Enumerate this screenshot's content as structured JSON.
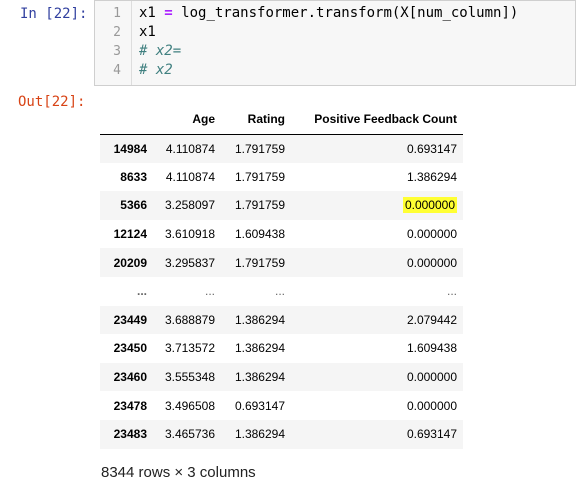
{
  "input_prompt": "In [22]:",
  "output_prompt": "Out[22]:",
  "code": {
    "line_numbers": [
      "1",
      "2",
      "3",
      "4"
    ],
    "line1_pre": "x1 ",
    "line1_op": "=",
    "line1_post": " log_transformer.transform(X[num_column])",
    "line2": "x1",
    "line3": "# x2=",
    "line4": "# x2"
  },
  "table": {
    "columns": [
      "Age",
      "Rating",
      "Positive Feedback Count"
    ],
    "rows": [
      [
        "14984",
        "4.110874",
        "1.791759",
        "0.693147"
      ],
      [
        "8633",
        "4.110874",
        "1.791759",
        "1.386294"
      ],
      [
        "5366",
        "3.258097",
        "1.791759",
        "0.000000"
      ],
      [
        "12124",
        "3.610918",
        "1.609438",
        "0.000000"
      ],
      [
        "20209",
        "3.295837",
        "1.791759",
        "0.000000"
      ],
      [
        "...",
        "...",
        "...",
        "..."
      ],
      [
        "23449",
        "3.688879",
        "1.386294",
        "2.079442"
      ],
      [
        "23450",
        "3.713572",
        "1.386294",
        "1.609438"
      ],
      [
        "23460",
        "3.555348",
        "1.386294",
        "0.000000"
      ],
      [
        "23478",
        "3.496508",
        "0.693147",
        "0.000000"
      ],
      [
        "23483",
        "3.465736",
        "1.386294",
        "0.693147"
      ]
    ],
    "highlight": {
      "row": 2,
      "col": 3,
      "color": "#ffff33"
    }
  },
  "footer": "8344 rows × 3 columns",
  "colors": {
    "in_prompt": "#303f9f",
    "out_prompt": "#d84315",
    "comment": "#408080"
  }
}
